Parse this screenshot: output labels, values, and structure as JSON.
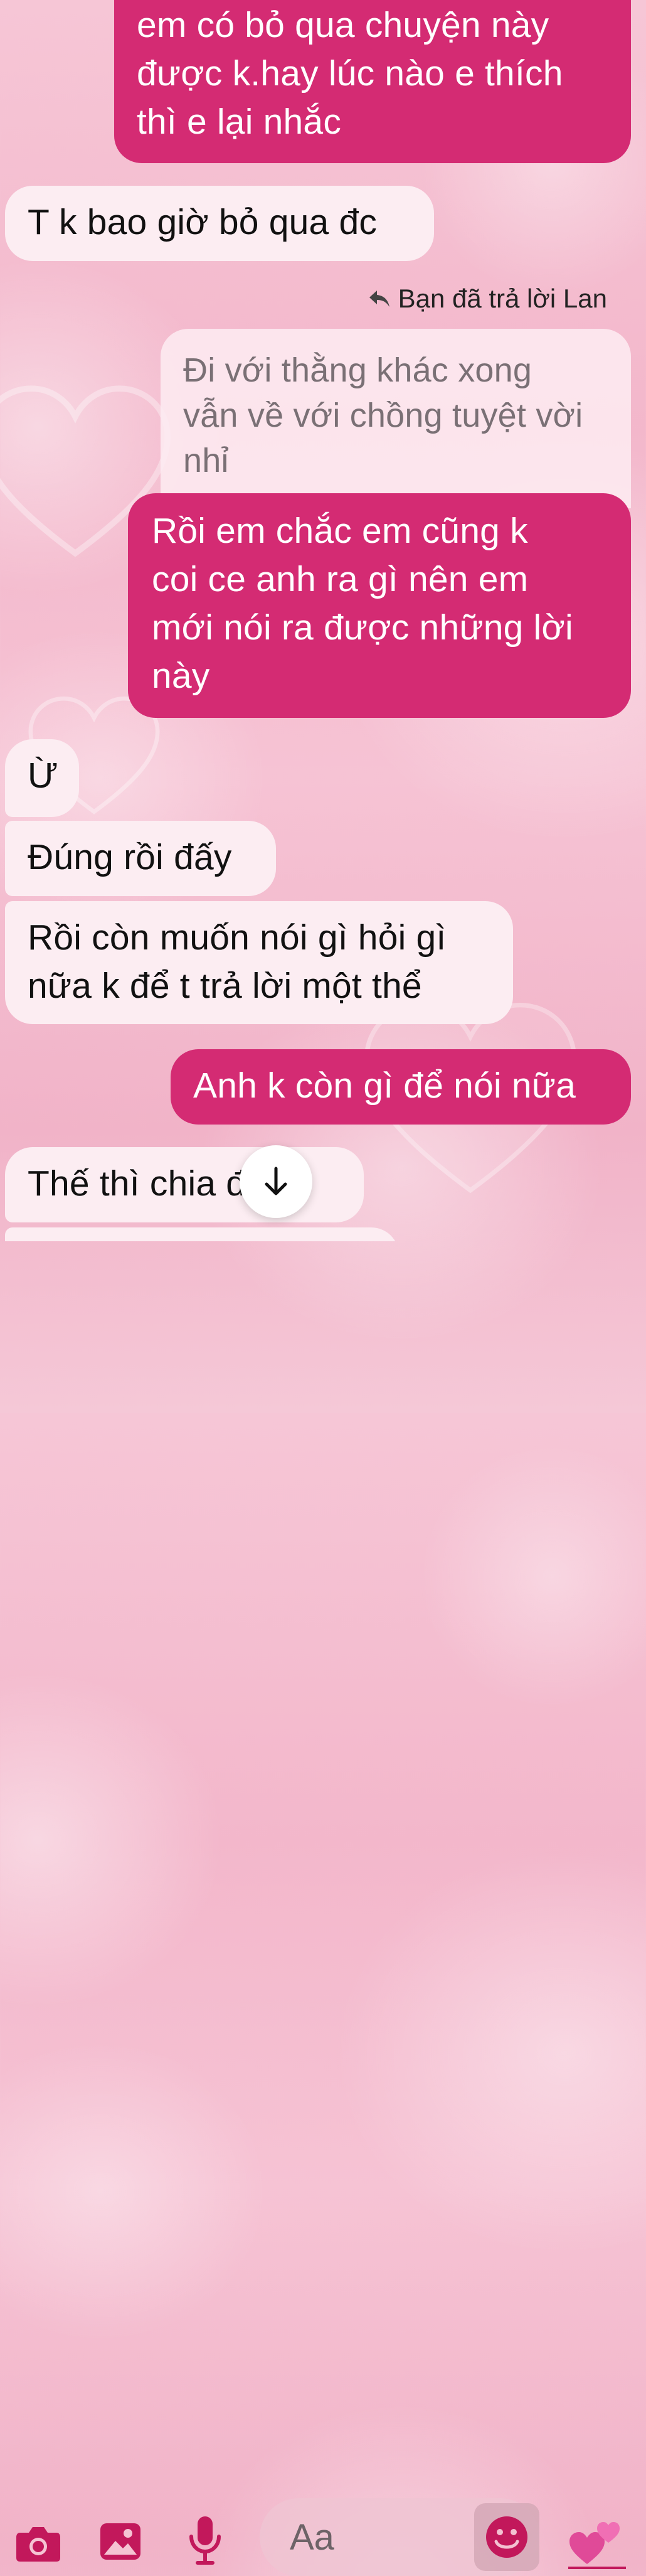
{
  "messages": [
    {
      "id": "m1",
      "side": "me",
      "text": "em có bỏ qua chuyện này\nđược k.hay lúc nào e thích\nthì e lại nhắc"
    },
    {
      "id": "m2",
      "side": "them",
      "text": "T k bao giờ bỏ qua đc"
    },
    {
      "id": "m3_reply_note",
      "text": "Bạn đã trả lời Lan"
    },
    {
      "id": "m3_quoted",
      "text": "Đi với thằng khác xong\nvẫn về với chồng tuyệt vời\nnhỉ"
    },
    {
      "id": "m3",
      "side": "me",
      "text": "Rồi em chắc em cũng k\ncoi ce anh ra gì nên em\nmới nói ra được những lời\nnày"
    },
    {
      "id": "m4",
      "side": "them",
      "text": "Ừ"
    },
    {
      "id": "m5",
      "side": "them",
      "text": "Đúng rồi đấy"
    },
    {
      "id": "m6",
      "side": "them",
      "text": "Rồi còn muốn nói gì hỏi gì\nnữa k để t trả lời một thể"
    },
    {
      "id": "m7",
      "side": "me",
      "text": "Anh k còn gì để nói nữa"
    },
    {
      "id": "m8",
      "side": "them",
      "text": "Thế thì chia    đi"
    }
  ],
  "composer": {
    "placeholder": "Aa",
    "icons": [
      "camera-icon",
      "photo-icon",
      "microphone-icon",
      "emoji-icon",
      "hearts-icon"
    ]
  },
  "colors": {
    "outgoing_bubble": "#d42b73",
    "incoming_bubble": "#fcedf2",
    "accent": "#c2185b"
  }
}
